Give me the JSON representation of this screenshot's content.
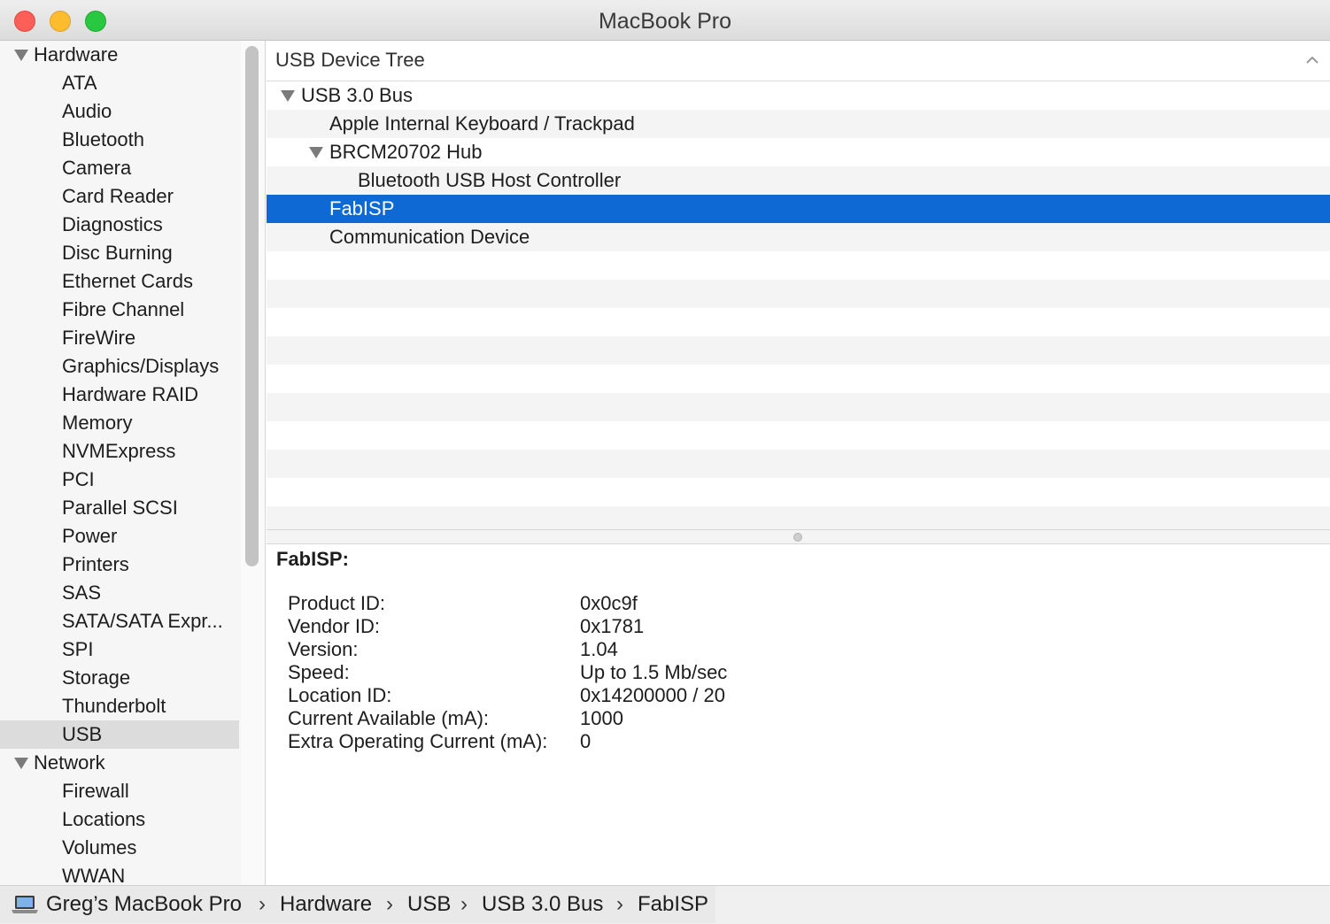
{
  "window": {
    "title": "MacBook Pro"
  },
  "sidebar": {
    "groups": [
      {
        "label": "Hardware",
        "items": [
          "ATA",
          "Audio",
          "Bluetooth",
          "Camera",
          "Card Reader",
          "Diagnostics",
          "Disc Burning",
          "Ethernet Cards",
          "Fibre Channel",
          "FireWire",
          "Graphics/Displays",
          "Hardware RAID",
          "Memory",
          "NVMExpress",
          "PCI",
          "Parallel SCSI",
          "Power",
          "Printers",
          "SAS",
          "SATA/SATA Expr...",
          "SPI",
          "Storage",
          "Thunderbolt",
          "USB"
        ]
      },
      {
        "label": "Network",
        "items": [
          "Firewall",
          "Locations",
          "Volumes",
          "WWAN"
        ]
      }
    ],
    "selected": "USB"
  },
  "tree": {
    "header": "USB Device Tree",
    "rows": [
      {
        "label": "USB 3.0 Bus",
        "depth": 0,
        "expanded": true
      },
      {
        "label": "Apple Internal Keyboard / Trackpad",
        "depth": 1
      },
      {
        "label": "BRCM20702 Hub",
        "depth": 1,
        "expanded": true
      },
      {
        "label": "Bluetooth USB Host Controller",
        "depth": 2
      },
      {
        "label": "FabISP",
        "depth": 1,
        "selected": true
      },
      {
        "label": "Communication Device",
        "depth": 1
      }
    ]
  },
  "details": {
    "title": "FabISP:",
    "fields": [
      {
        "key": "Product ID:",
        "value": "0x0c9f"
      },
      {
        "key": "Vendor ID:",
        "value": "0x1781"
      },
      {
        "key": "Version:",
        "value": "1.04"
      },
      {
        "key": "Speed:",
        "value": "Up to 1.5 Mb/sec"
      },
      {
        "key": "Location ID:",
        "value": "0x14200000 / 20"
      },
      {
        "key": "Current Available (mA):",
        "value": "1000"
      },
      {
        "key": "Extra Operating Current (mA):",
        "value": "0"
      }
    ]
  },
  "pathbar": {
    "icon": "laptop-icon",
    "crumbs": [
      "Greg’s MacBook Pro",
      "Hardware",
      "USB",
      "USB 3.0 Bus",
      "FabISP"
    ],
    "separator": "›"
  },
  "colors": {
    "selection": "#0f69d5",
    "close": "#fc5f57",
    "minimize": "#fdbc2e",
    "zoom": "#28c840"
  }
}
